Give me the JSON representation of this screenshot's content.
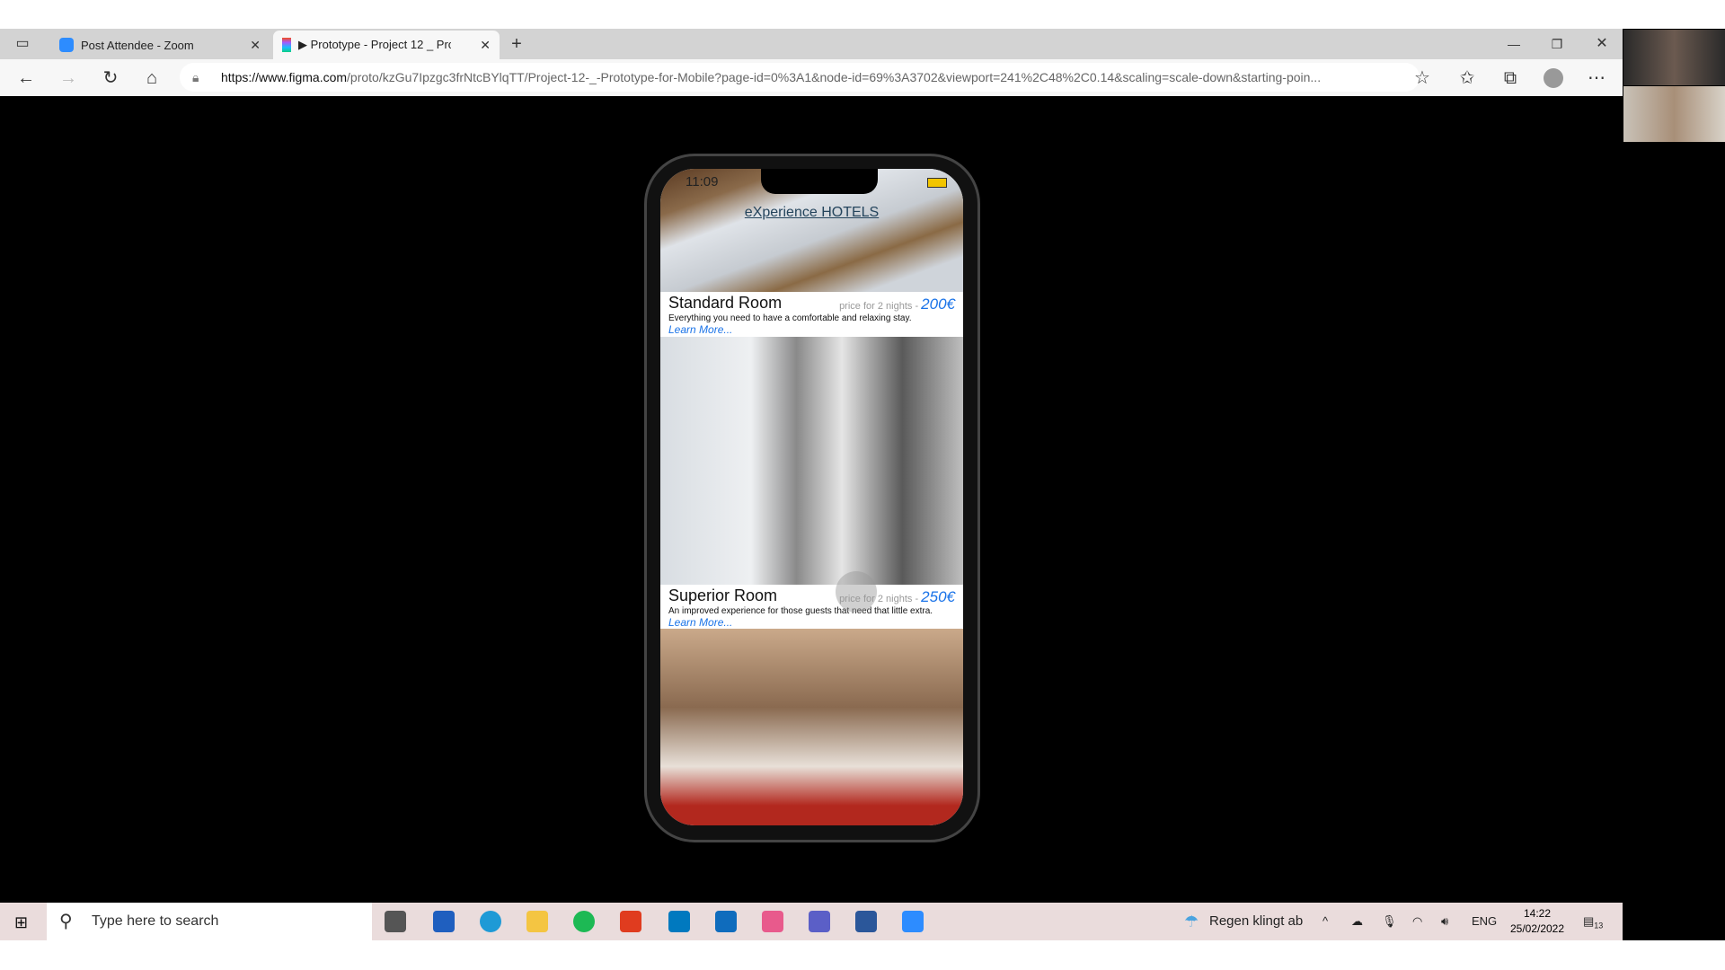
{
  "browser": {
    "tabs": [
      {
        "label": "Post Attendee - Zoom",
        "icon": "zoom-icon"
      },
      {
        "label": "▶ Prototype - Project 12 _ Proto",
        "icon": "figma-icon",
        "active": true
      }
    ],
    "url_domain": "https://www.figma.com",
    "url_path": "/proto/kzGu7Ipzgc3frNtcBYlqTT/Project-12-_-Prototype-for-Mobile?page-id=0%3A1&node-id=69%3A3702&viewport=241%2C48%2C0.14&scaling=scale-down&starting-poin..."
  },
  "phone": {
    "time": "11:09",
    "brand": "eXperience HOTELS",
    "rooms": [
      {
        "name": "Standard Room",
        "price_label": "price for 2 nights",
        "price": "200€",
        "description": "Everything you need to have a comfortable and relaxing stay.",
        "link": "Learn More..."
      },
      {
        "name": "Superior Room",
        "price_label": "price for 2 nights",
        "price": "250€",
        "description": "An improved experience for those guests that need that little extra.",
        "link": "Learn More..."
      }
    ]
  },
  "taskbar": {
    "search_placeholder": "Type here to search",
    "weather": "Regen klingt ab",
    "language": "ENG",
    "time": "14:22",
    "date": "25/02/2022",
    "notifications": "13"
  },
  "colors": {
    "accent": "#1a73e8",
    "taskbar": "#eadcdc"
  }
}
